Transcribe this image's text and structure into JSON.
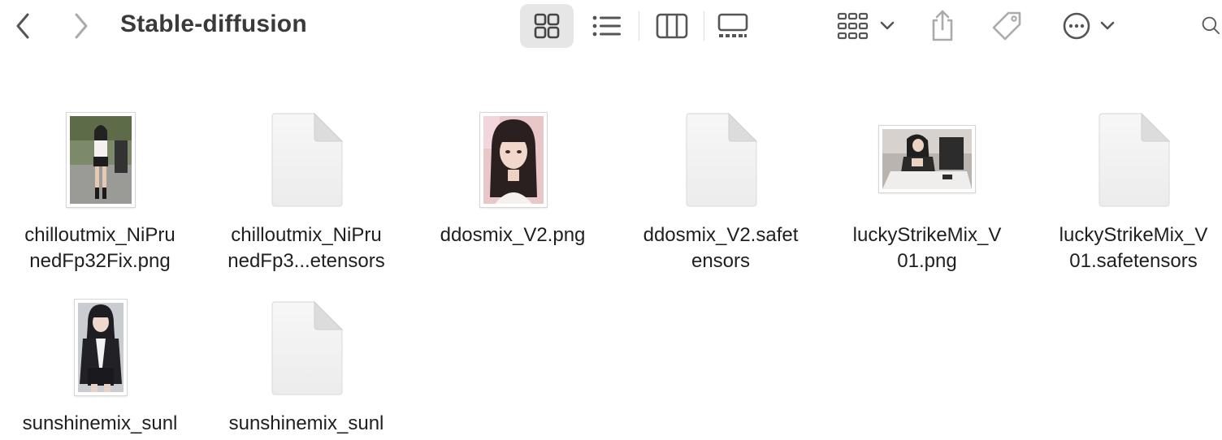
{
  "toolbar": {
    "title": "Stable-diffusion",
    "back_icon": "chevron-left-icon",
    "forward_icon": "chevron-right-icon",
    "views": [
      "grid-view-icon",
      "list-view-icon",
      "column-view-icon",
      "gallery-view-icon"
    ],
    "active_view": "grid-view-icon",
    "group_icon": "group-icon",
    "share_icon": "share-icon",
    "tag_icon": "tag-icon",
    "more_icon": "more-icon",
    "search_icon": "search-icon"
  },
  "files": [
    {
      "line1": "chilloutmix_NiPru",
      "line2": "nedFp32Fix.png",
      "kind": "image"
    },
    {
      "line1": "chilloutmix_NiPru",
      "line2": "nedFp3...etensors",
      "kind": "document"
    },
    {
      "line1": "ddosmix_V2.png",
      "line2": "",
      "kind": "image"
    },
    {
      "line1": "ddosmix_V2.safet",
      "line2": "ensors",
      "kind": "document"
    },
    {
      "line1": "luckyStrikeMix_V",
      "line2": "01.png",
      "kind": "image"
    },
    {
      "line1": "luckyStrikeMix_V",
      "line2": "01.safetensors",
      "kind": "document"
    },
    {
      "line1": "sunshinemix_sunl",
      "line2": "",
      "kind": "image"
    },
    {
      "line1": "sunshinemix_sunl",
      "line2": "",
      "kind": "document"
    }
  ]
}
